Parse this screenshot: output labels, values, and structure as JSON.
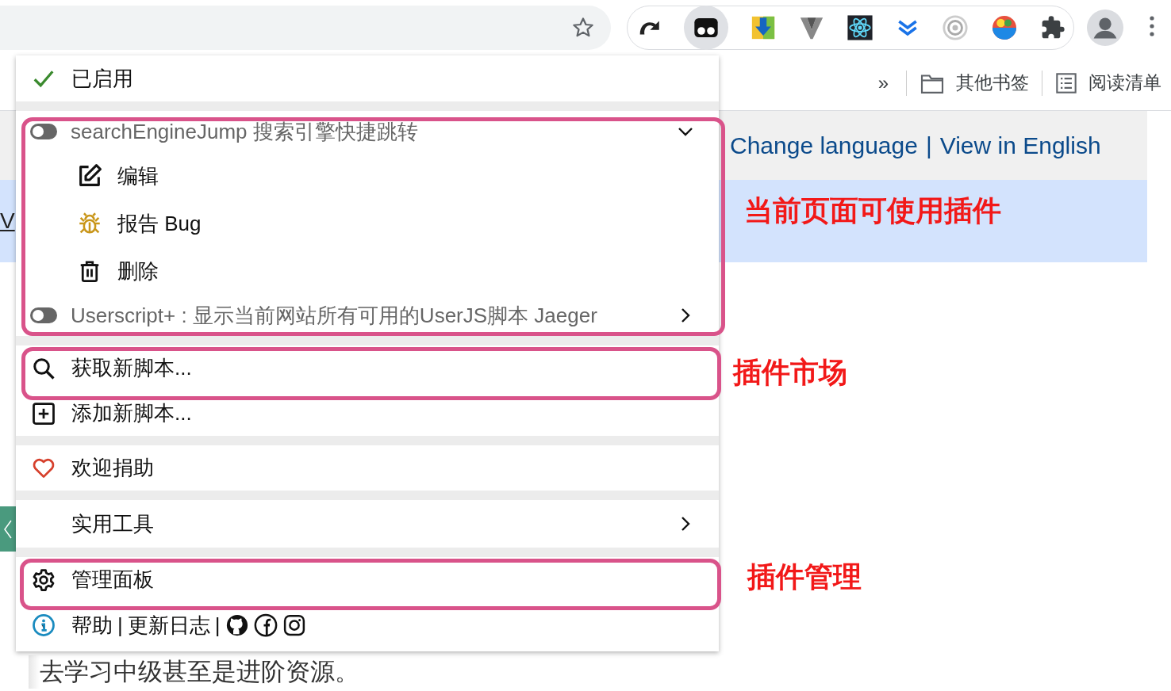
{
  "bookmarks_bar": {
    "overflow": "»",
    "items": [
      {
        "kind": "folder",
        "label": "其他书签"
      },
      {
        "kind": "list",
        "label": "阅读清单"
      }
    ]
  },
  "page": {
    "links": [
      "Change language",
      "|",
      "View in English"
    ],
    "fragment": "V",
    "footer_text": "去学习中级甚至是进阶资源。"
  },
  "menu": {
    "sections": [
      {
        "items": [
          {
            "kind": "status",
            "label": "已启用",
            "checked": true
          }
        ]
      },
      {
        "items": [
          {
            "kind": "script",
            "label": "searchEngineJump 搜索引擎快捷跳转",
            "on": false,
            "expanded": true,
            "actions": [
              {
                "kind": "edit",
                "label": "编辑"
              },
              {
                "kind": "bug",
                "label": "报告 Bug"
              },
              {
                "kind": "delete",
                "label": "删除"
              }
            ]
          },
          {
            "kind": "script",
            "label": "Userscript+ : 显示当前网站所有可用的UserJS脚本 Jaeger",
            "on": false,
            "expanded": false
          }
        ]
      },
      {
        "items": [
          {
            "kind": "search",
            "label": "获取新脚本..."
          },
          {
            "kind": "add",
            "label": "添加新脚本..."
          }
        ]
      },
      {
        "items": [
          {
            "kind": "heart",
            "label": "欢迎捐助"
          }
        ]
      },
      {
        "items": [
          {
            "kind": "submenu",
            "label": "实用工具"
          }
        ]
      },
      {
        "items": [
          {
            "kind": "gear",
            "label": "管理面板"
          },
          {
            "kind": "links",
            "parts": [
              {
                "kind": "link",
                "label": "帮助"
              },
              {
                "kind": "sep",
                "label": "|"
              },
              {
                "kind": "link",
                "label": "更新日志"
              },
              {
                "kind": "sep",
                "label": "|"
              },
              {
                "kind": "github"
              },
              {
                "kind": "facebook"
              },
              {
                "kind": "instagram"
              }
            ]
          }
        ]
      }
    ]
  },
  "annotations": [
    {
      "label": "当前页面可使用插件"
    },
    {
      "label": "插件市场"
    },
    {
      "label": "插件管理"
    }
  ]
}
